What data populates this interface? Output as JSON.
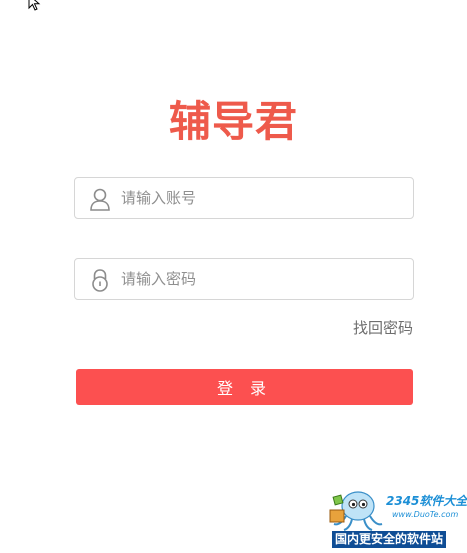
{
  "app": {
    "logo_text": "辅导君"
  },
  "login_form": {
    "account": {
      "placeholder": "请输入账号",
      "value": "",
      "icon": "user-icon"
    },
    "password": {
      "placeholder": "请输入密码",
      "value": "",
      "icon": "lock-icon"
    },
    "forgot_password_label": "找回密码",
    "login_button_label": "登 录"
  },
  "watermark": {
    "brand": "2345软件大全",
    "url": "www.DuoTe.com",
    "slogan": "国内更安全的软件站",
    "icon": "mascot-icon"
  },
  "colors": {
    "brand": "#ee5a4b",
    "button": "#fc5050",
    "placeholder": "#8f8f8f",
    "border": "#d6d6d6"
  }
}
